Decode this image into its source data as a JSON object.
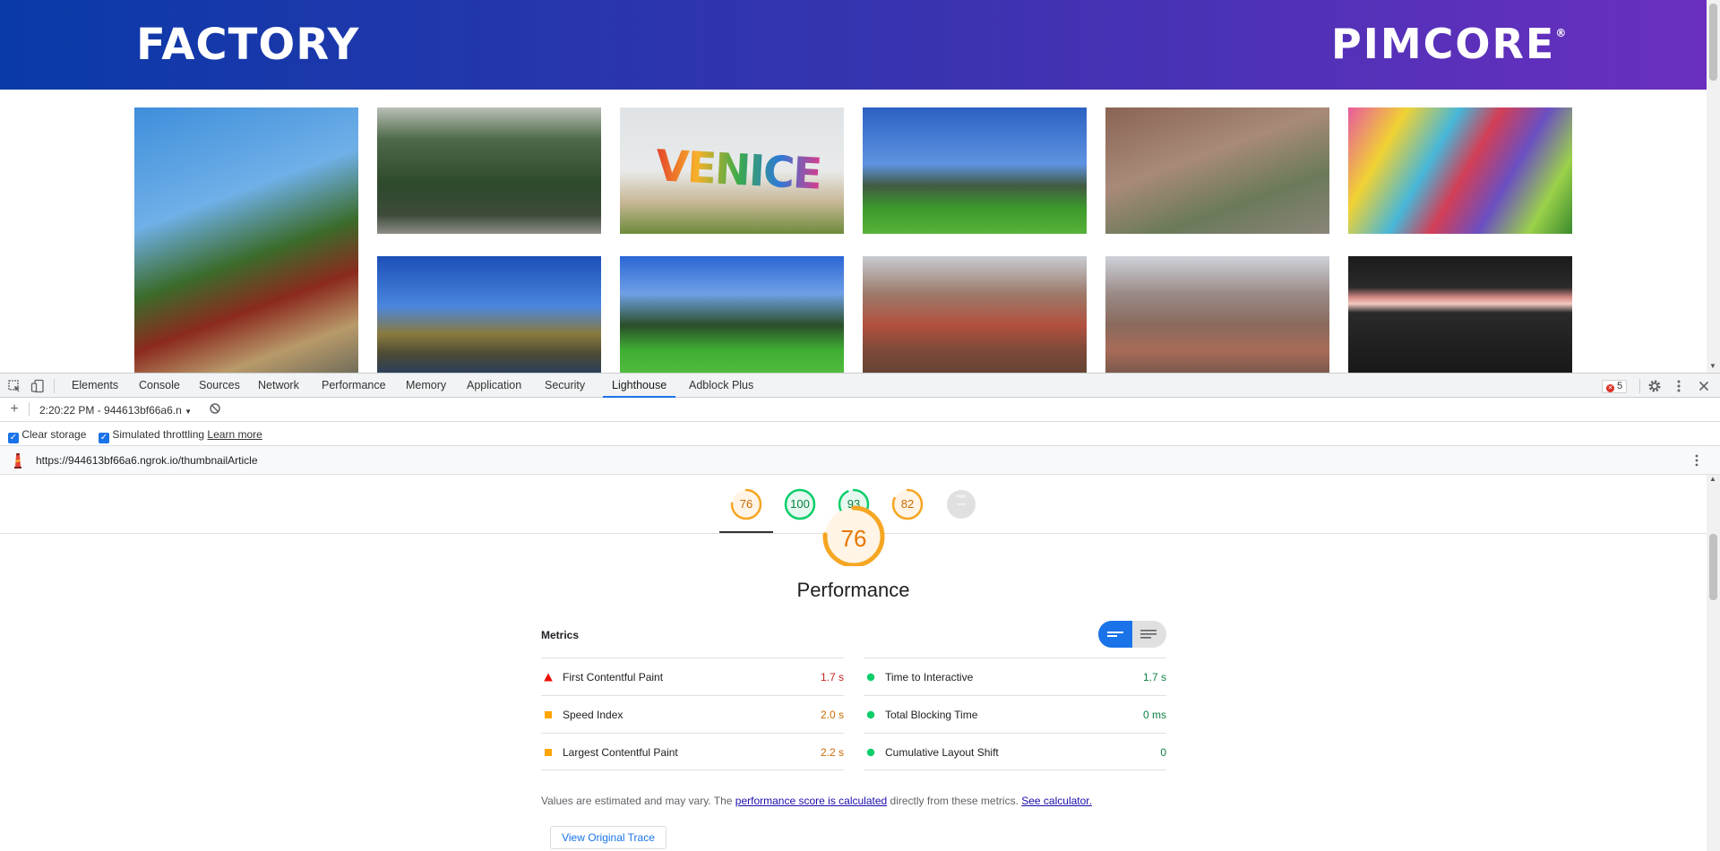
{
  "site": {
    "brand_left": "FACTORY",
    "brand_right": "PIMCORE",
    "brand_right_mark": "®",
    "gallery_overlay": "VENICE"
  },
  "devtools": {
    "tabs": [
      {
        "label": "Elements"
      },
      {
        "label": "Console"
      },
      {
        "label": "Sources"
      },
      {
        "label": "Network"
      },
      {
        "label": "Performance"
      },
      {
        "label": "Memory"
      },
      {
        "label": "Application"
      },
      {
        "label": "Security"
      },
      {
        "label": "Lighthouse",
        "active": true
      },
      {
        "label": "Adblock Plus"
      }
    ],
    "error_count": "5",
    "report_selector": "2:20:22 PM - 944613bf66a6.n",
    "clear_storage_label": "Clear storage",
    "throttling_label": "Simulated throttling",
    "learn_more": "Learn more",
    "url": "https://944613bf66a6.ngrok.io/thumbnailArticle"
  },
  "lighthouse": {
    "gauges": [
      {
        "value": "76",
        "score": 76,
        "color": "#f5a623"
      },
      {
        "value": "100",
        "score": 100,
        "color": "#0cce6b"
      },
      {
        "value": "93",
        "score": 93,
        "color": "#0cce6b"
      },
      {
        "value": "82",
        "score": 82,
        "color": "#f5a623"
      },
      {
        "value": "–",
        "badge": "PWA",
        "score": 0,
        "color": "#9e9e9e"
      }
    ],
    "performance": {
      "score": "76",
      "title": "Performance",
      "metrics_title": "Metrics",
      "left_metrics": [
        {
          "name": "First Contentful Paint",
          "value": "1.7 s",
          "status": "fail"
        },
        {
          "name": "Speed Index",
          "value": "2.0 s",
          "status": "average"
        },
        {
          "name": "Largest Contentful Paint",
          "value": "2.2 s",
          "status": "average"
        }
      ],
      "right_metrics": [
        {
          "name": "Time to Interactive",
          "value": "1.7 s",
          "status": "pass"
        },
        {
          "name": "Total Blocking Time",
          "value": "0 ms",
          "status": "pass"
        },
        {
          "name": "Cumulative Layout Shift",
          "value": "0",
          "status": "pass"
        }
      ],
      "note_prefix": "Values are estimated and may vary. The ",
      "note_link1": "performance score is calculated",
      "note_middle": " directly from these metrics. ",
      "note_link2": "See calculator.",
      "trace_button": "View Original Trace"
    }
  }
}
